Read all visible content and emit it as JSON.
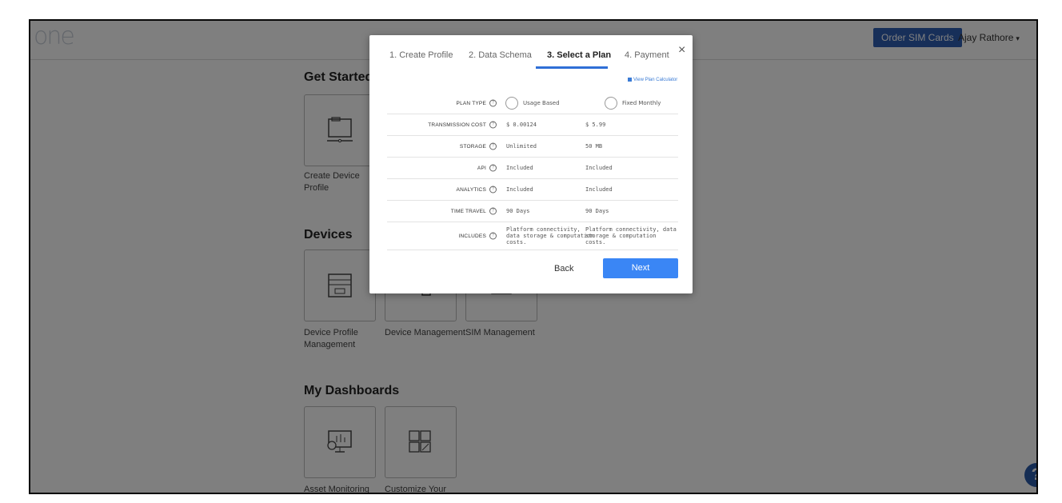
{
  "header": {
    "logo_text": "one",
    "order_button": "Order SIM Cards",
    "user_name": "Ajay Rathore",
    "user_caret": "▾"
  },
  "sections": {
    "get_started": {
      "title": "Get Started",
      "tiles": [
        {
          "label_line1": "Create Device",
          "label_line2": "Profile",
          "icon": "folder-device-icon"
        }
      ]
    },
    "devices": {
      "title": "Devices",
      "tiles": [
        {
          "label_line1": "Device Profile",
          "label_line2": "Management",
          "icon": "file-cabinet-icon"
        },
        {
          "label_line1": "Device Management",
          "label_line2": "",
          "icon": "devices-icon"
        },
        {
          "label_line1": "SIM Management",
          "label_line2": "",
          "icon": "sim-card-icon"
        }
      ]
    },
    "dashboards": {
      "title": "My Dashboards",
      "tiles": [
        {
          "label_line1": "Asset Monitoring",
          "label_line2": "",
          "icon": "monitor-chart-icon"
        },
        {
          "label_line1": "Customize Your",
          "label_line2": "",
          "icon": "customize-layout-icon"
        }
      ]
    }
  },
  "help_button": "?",
  "modal": {
    "close": "×",
    "tabs": [
      {
        "label": "1. Create Profile",
        "active": false
      },
      {
        "label": "2. Data Schema",
        "active": false
      },
      {
        "label": "3. Select a Plan",
        "active": true
      },
      {
        "label": "4. Payment",
        "active": false
      }
    ],
    "calculator_link": "View Plan Calculator",
    "plan_type_label": "PLAN TYPE",
    "plans": [
      "Usage Based",
      "Fixed Monthly"
    ],
    "rows": [
      {
        "label": "TRANSMISSION COST",
        "v1": "$ 0.00124",
        "v2": "$ 5.99"
      },
      {
        "label": "STORAGE",
        "v1": "Unlimited",
        "v2": "50 MB"
      },
      {
        "label": "API",
        "v1": "Included",
        "v2": "Included"
      },
      {
        "label": "ANALYTICS",
        "v1": "Included",
        "v2": "Included"
      },
      {
        "label": "TIME TRAVEL",
        "v1": "90 Days",
        "v2": "90 Days"
      },
      {
        "label": "INCLUDES",
        "v1": "Platform connectivity, data storage & computation costs.",
        "v2": "Platform connectivity, data storage & computation costs."
      }
    ],
    "back_label": "Back",
    "next_label": "Next"
  },
  "colors": {
    "accent_blue": "#3a86f5",
    "order_button_blue": "#2f5fb3",
    "help_blue": "#2a5aa8"
  }
}
